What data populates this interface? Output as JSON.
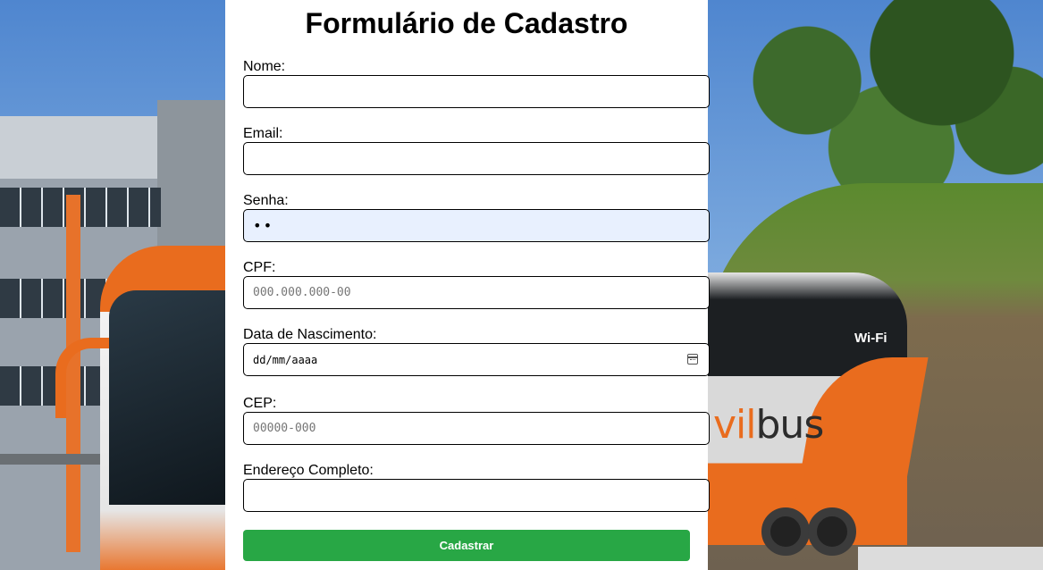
{
  "form": {
    "title": "Formulário de Cadastro",
    "fields": [
      {
        "label": "Nome:",
        "value": "",
        "placeholder": ""
      },
      {
        "label": "Email:",
        "value": "",
        "placeholder": ""
      },
      {
        "label": "Senha:",
        "value": "••",
        "placeholder": ""
      },
      {
        "label": "CPF:",
        "value": "",
        "placeholder": "000.000.000-00"
      },
      {
        "label": "Data de Nascimento:",
        "value": "dd/mm/aaaa",
        "placeholder": ""
      },
      {
        "label": "CEP:",
        "value": "",
        "placeholder": "00000-000"
      },
      {
        "label": "Endereço Completo:",
        "value": "",
        "placeholder": ""
      }
    ],
    "submit_label": "Cadastrar"
  },
  "background": {
    "bus_brand_prefix": "vil",
    "bus_brand_suffix": "bus",
    "wifi_badge": "Wi-Fi",
    "colors": {
      "accent": "#28a745",
      "bus_orange": "#e96c1e",
      "autofill": "#e8f0fe"
    }
  },
  "icons": {
    "date_picker": "calendar-icon"
  }
}
